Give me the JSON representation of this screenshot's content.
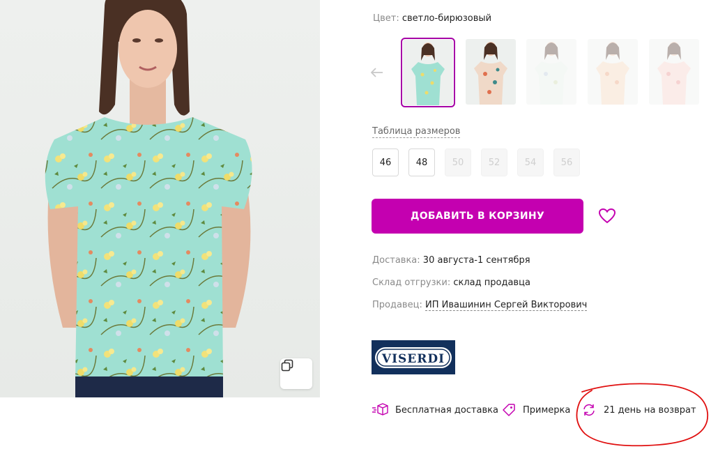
{
  "product": {
    "color_label": "Цвет:",
    "color_value": "светло-бирюзовый",
    "photo_icon": "model-in-floral-top-photo",
    "zoom_icon": "copy-icon"
  },
  "thumbnails": {
    "prev_icon": "arrow-left-icon",
    "items": [
      {
        "name": "mint-floral",
        "state": "selected"
      },
      {
        "name": "coral-floral",
        "state": "available"
      },
      {
        "name": "pale-floral",
        "state": "unavailable"
      },
      {
        "name": "peach-floral",
        "state": "unavailable"
      },
      {
        "name": "pink-floral",
        "state": "unavailable"
      }
    ]
  },
  "sizes": {
    "table_link": "Таблица размеров",
    "items": [
      {
        "label": "46",
        "available": true
      },
      {
        "label": "48",
        "available": true
      },
      {
        "label": "50",
        "available": false
      },
      {
        "label": "52",
        "available": false
      },
      {
        "label": "54",
        "available": false
      },
      {
        "label": "56",
        "available": false
      }
    ]
  },
  "actions": {
    "add_to_cart": "ДОБАВИТЬ В КОРЗИНУ",
    "favorite_icon": "heart-icon"
  },
  "delivery": {
    "delivery_label": "Доставка:",
    "delivery_value": "30 августа-1 сентября",
    "warehouse_label": "Склад отгрузки:",
    "warehouse_value": "склад продавца",
    "seller_label": "Продавец:",
    "seller_value": "ИП Ивашинин Сергей Викторович"
  },
  "brand": {
    "logo_text": "VISERDI"
  },
  "features": {
    "free_delivery": "Бесплатная доставка",
    "fitting": "Примерка",
    "returns": "21 день на возврат"
  },
  "colors": {
    "accent": "#c400b0",
    "thumb_outline": "#a600a6",
    "brand_bg": "#12305c",
    "annotation_red": "#e01010"
  }
}
